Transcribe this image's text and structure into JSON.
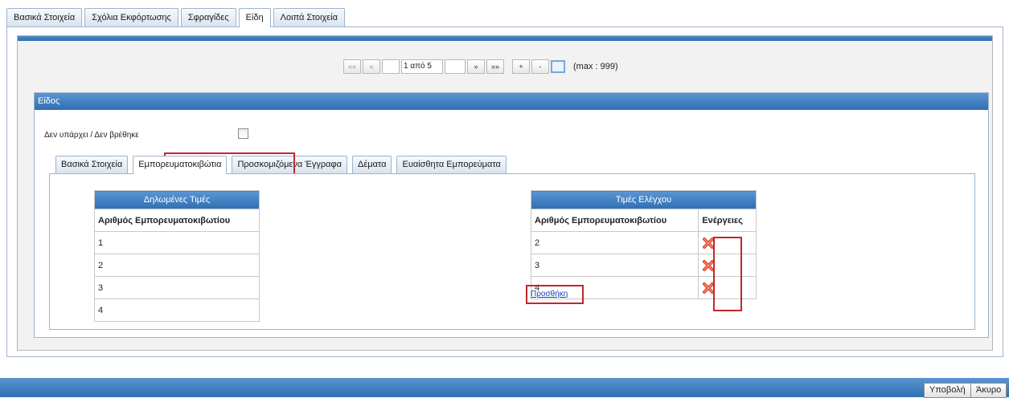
{
  "top_tabs": [
    "Βασικά Στοιχεία",
    "Σχόλια Εκφόρτωσης",
    "Σφραγίδες",
    "Είδη",
    "Λοιπά Στοιχεία"
  ],
  "pager": {
    "first": "««",
    "prev": "«",
    "page_text": "1 από 5",
    "next": "»",
    "last": "»»",
    "add": "+",
    "remove": "-",
    "max_label": "(max : 999)"
  },
  "section": {
    "title": "Είδος",
    "not_found_label": "Δεν υπάρχει / Δεν βρέθηκε",
    "sub_tabs": [
      "Βασικά Στοιχεία",
      "Εμπορευματοκιβώτια",
      "Προσκομιζόμενα Έγγραφα",
      "Δέματα",
      "Ευαίσθητα Εμπορεύματα"
    ]
  },
  "declared": {
    "caption": "Δηλωμένες Τιμές",
    "column": "Αριθμός Εμπορευματοκιβωτίου",
    "rows": [
      "1",
      "2",
      "3",
      "4"
    ]
  },
  "control": {
    "caption": "Τιμές Ελέγχου",
    "column": "Αριθμός Εμπορευματοκιβωτίου",
    "actions_column": "Ενέργειες",
    "rows": [
      "2",
      "3",
      "4"
    ],
    "add_link": "Προσθήκη"
  },
  "buttons": {
    "submit": "Υποβολή",
    "cancel": "Άκυρο"
  },
  "colors": {
    "header_blue": "#2f6fb2",
    "highlight_red": "#c0272d",
    "delete_red": "#e0452c"
  }
}
